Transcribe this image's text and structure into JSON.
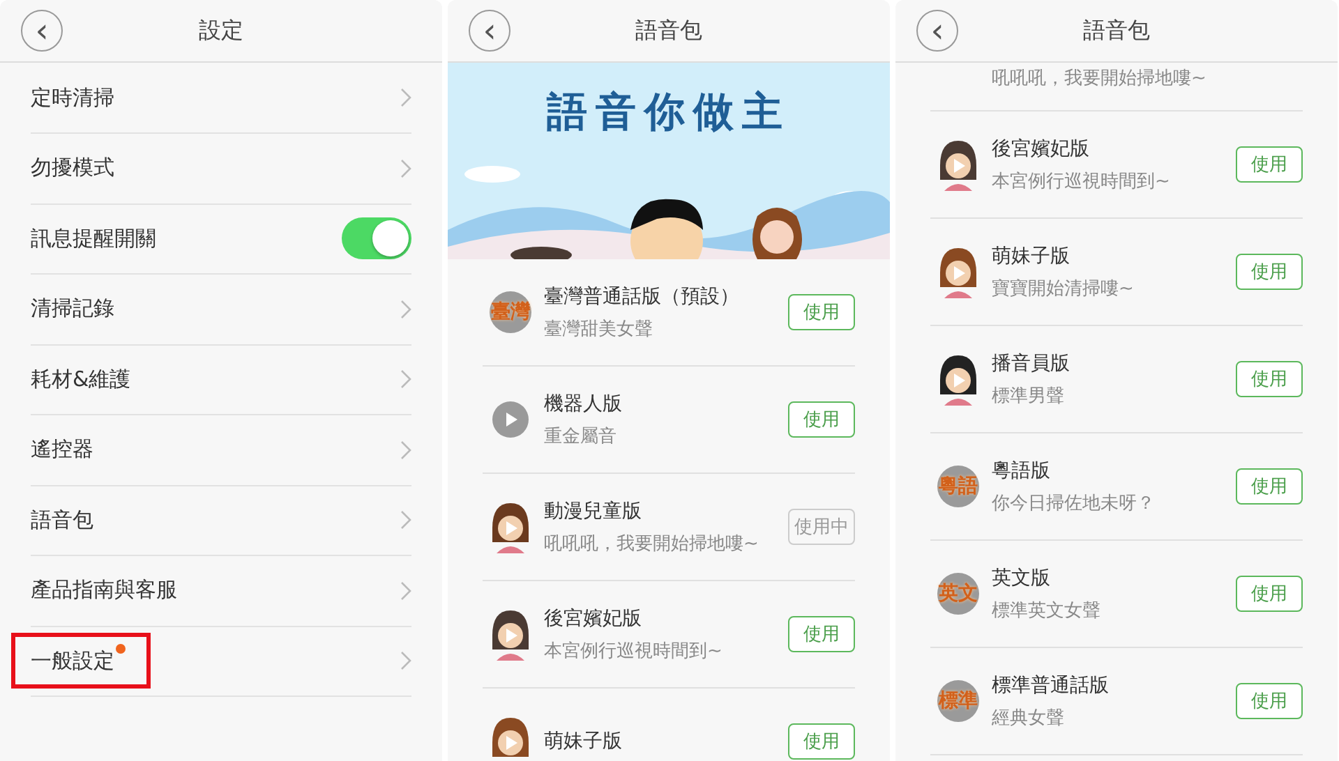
{
  "settings_screen": {
    "header": {
      "back": "‹",
      "title": "設定"
    },
    "items": [
      {
        "kind": "link",
        "label": "定時清掃",
        "dot": false,
        "highlighted": false
      },
      {
        "kind": "link",
        "label": "勿擾模式",
        "dot": false,
        "highlighted": false
      },
      {
        "kind": "toggle",
        "label": "訊息提醒開關",
        "on": true
      },
      {
        "kind": "link",
        "label": "清掃記錄",
        "dot": false,
        "highlighted": false
      },
      {
        "kind": "link",
        "label": "耗材&維護",
        "dot": false,
        "highlighted": false
      },
      {
        "kind": "link",
        "label": "遙控器",
        "dot": false,
        "highlighted": false
      },
      {
        "kind": "link",
        "label": "語音包",
        "dot": false,
        "highlighted": false
      },
      {
        "kind": "link",
        "label": "產品指南與客服",
        "dot": false,
        "highlighted": false
      },
      {
        "kind": "link",
        "label": "一般設定",
        "dot": true,
        "highlighted": true
      }
    ]
  },
  "voice_screen": {
    "header": {
      "back": "‹",
      "title": "語音包"
    },
    "banner": {
      "title": "語音你做主"
    },
    "packs": [
      {
        "kind": "text",
        "icon_text": "臺灣",
        "name": "臺灣普通話版（預設）",
        "subtitle": "臺灣甜美女聲",
        "button": "使用",
        "in_use": false
      },
      {
        "kind": "play",
        "name": "機器人版",
        "subtitle": "重金屬音",
        "button": "使用",
        "in_use": false
      },
      {
        "kind": "avatar",
        "color": "#6b3a1e",
        "name": "動漫兒童版",
        "subtitle": "吼吼吼，我要開始掃地嘍~",
        "button": "使用中",
        "in_use": true
      },
      {
        "kind": "avatar",
        "color": "#4a3a33",
        "name": "後宮嬪妃版",
        "subtitle": "本宮例行巡視時間到~",
        "button": "使用",
        "in_use": false
      },
      {
        "kind": "avatar",
        "color": "#8a4a22",
        "name": "萌妹子版",
        "button": "使用",
        "in_use": false
      }
    ]
  },
  "voice_screen_scrolled": {
    "header": {
      "back": "‹",
      "title": "語音包"
    },
    "top_subtitle": "吼吼吼，我要開始掃地嘍~",
    "packs": [
      {
        "kind": "avatar",
        "color": "#4a3a33",
        "name": "後宮嬪妃版",
        "subtitle": "本宮例行巡視時間到~",
        "button": "使用",
        "in_use": false
      },
      {
        "kind": "avatar",
        "color": "#8a4a22",
        "name": "萌妹子版",
        "subtitle": "寶寶開始清掃嘍~",
        "button": "使用",
        "in_use": false
      },
      {
        "kind": "avatar",
        "color": "#222222",
        "name": "播音員版",
        "subtitle": "標準男聲",
        "button": "使用",
        "in_use": false
      },
      {
        "kind": "text",
        "icon_text": "粵語",
        "name": "粵語版",
        "subtitle": "你今日掃佐地未呀？",
        "button": "使用",
        "in_use": false
      },
      {
        "kind": "text",
        "icon_text": "英文",
        "name": "英文版",
        "subtitle": "標準英文女聲",
        "button": "使用",
        "in_use": false
      },
      {
        "kind": "text",
        "icon_text": "標準",
        "name": "標準普通話版",
        "subtitle": "經典女聲",
        "button": "使用",
        "in_use": false
      }
    ]
  }
}
